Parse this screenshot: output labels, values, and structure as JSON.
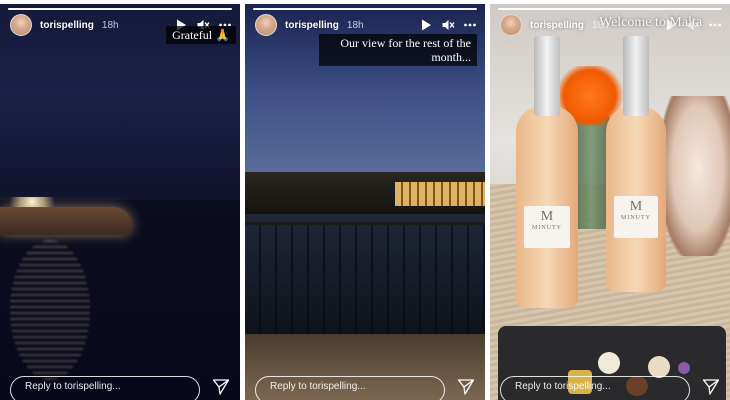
{
  "user": {
    "username": "torispelling"
  },
  "icons": {
    "play": "play-icon",
    "mute": "mute-icon",
    "more": "more-icon",
    "send": "send-icon"
  },
  "stories": [
    {
      "time": "18h",
      "caption": "Grateful 🙏",
      "reply_placeholder": "Reply to torispelling..."
    },
    {
      "time": "18h",
      "caption": "Our view for the rest of the month...",
      "reply_placeholder": "Reply to torispelling..."
    },
    {
      "time": "18h",
      "caption": "Welcome to Malta",
      "bottle_label_letter": "M",
      "bottle_label_name": "MINUTY",
      "reply_placeholder": "Reply to torispelling..."
    }
  ]
}
